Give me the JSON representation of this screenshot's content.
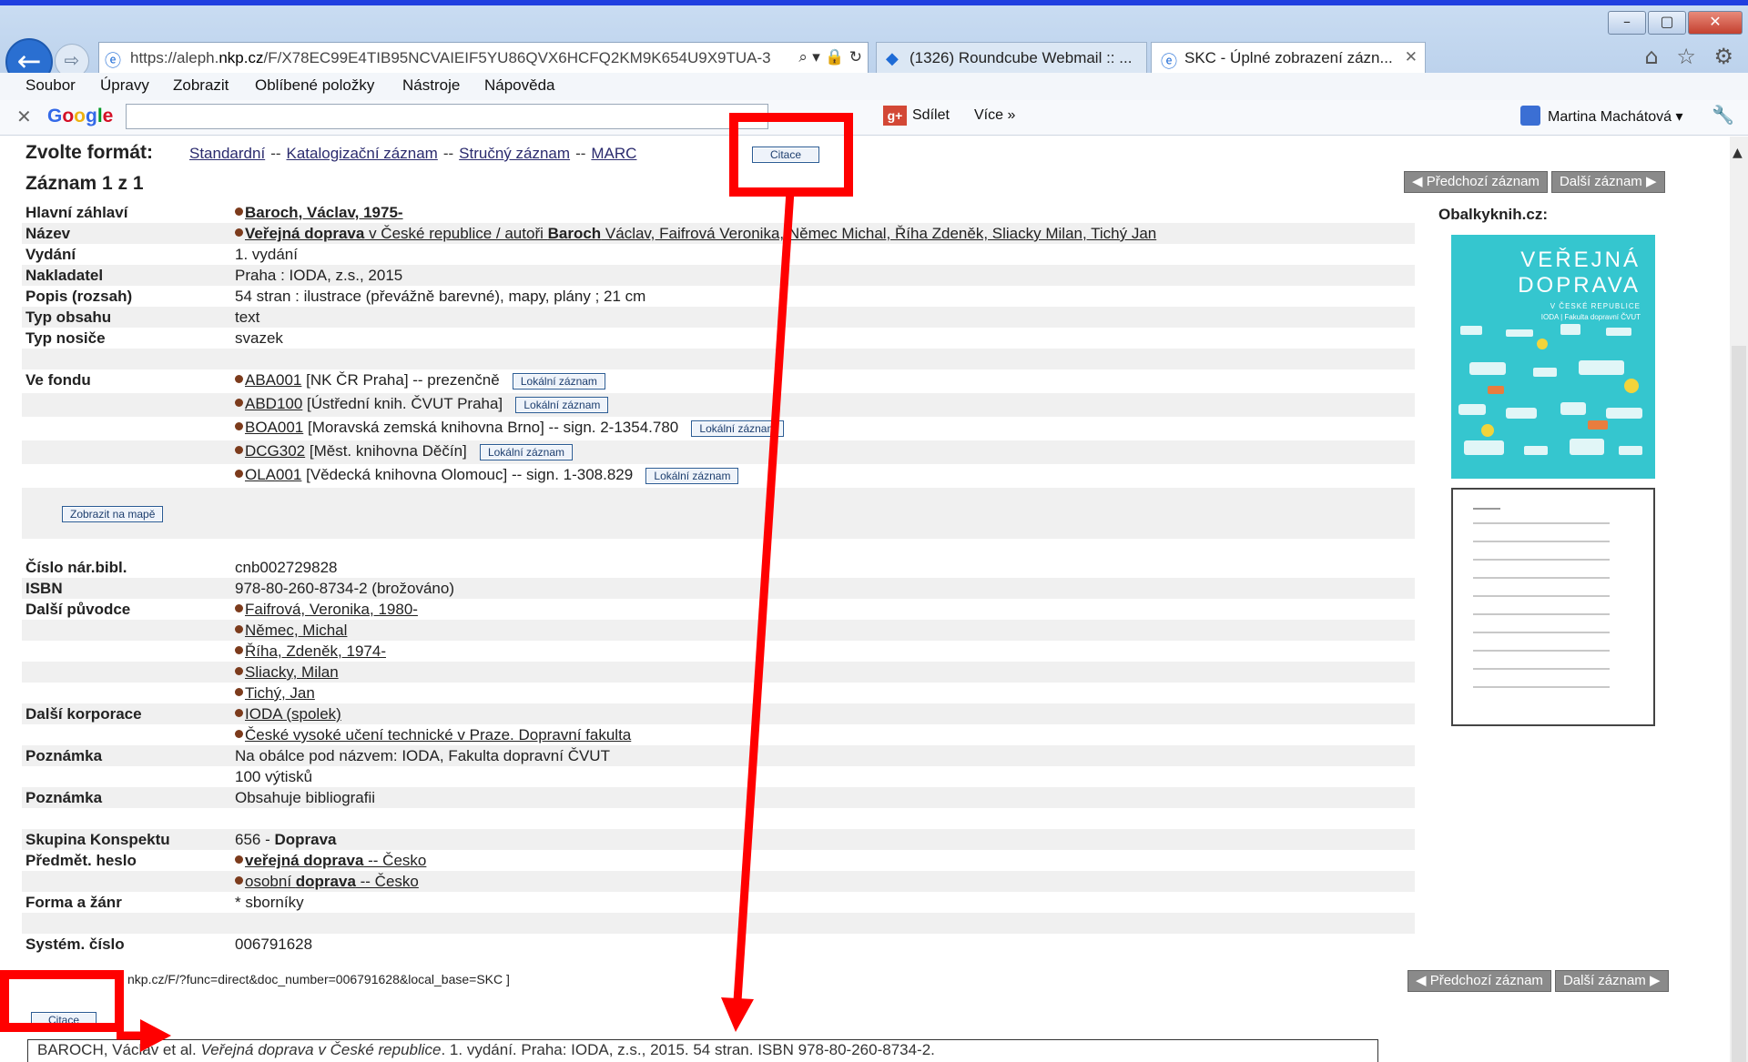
{
  "browser": {
    "url_prefix": "https://aleph.",
    "url_domain": "nkp.cz",
    "url_rest": "/F/X78EC99E4TIB95NCVAIEIF5YU86QVX6HCFQ2KM9K654U9X9TUA-3",
    "addr_tools": "⌕ ▾ 🔒 ↻",
    "tabs": [
      {
        "label": "(1326) Roundcube Webmail :: ..."
      },
      {
        "label": "SKC - Úplné zobrazení zázn...",
        "close": "✕"
      }
    ],
    "window_buttons": [
      "–",
      "▢",
      "✕"
    ],
    "tool_icons": "⌂ ☆ ⚙"
  },
  "menu": [
    "Soubor",
    "Úpravy",
    "Zobrazit",
    "Oblíbené položky",
    "Nástroje",
    "Nápověda"
  ],
  "google_toolbar": {
    "close": "✕",
    "logo": "Google",
    "share": "Sdílet",
    "more": "Více »",
    "user": "Martina Machátová ▾",
    "wrench": "🔧"
  },
  "page": {
    "format_label": "Zvolte formát:",
    "formats": [
      "Standardní",
      "Katalogizační záznam",
      "Stručný záznam",
      "MARC"
    ],
    "format_sep": "--",
    "citace_button": "Citace",
    "record_title": "Záznam 1 z 1",
    "prev_record": "◀ Předchozí záznam",
    "next_record": "Další záznam ▶",
    "cover_label": "Obalkyknih.cz:",
    "cover_title_1": "VEŘEJNÁ",
    "cover_title_2": "DOPRAVA",
    "cover_subtitle": "V ČESKÉ REPUBLICE",
    "cover_footer": "IODA | Fakulta dopravní ČVUT",
    "map_button": "Zobrazit na mapě",
    "local_record_button": "Lokální záznam",
    "fields": {
      "hlavni_zahlavi": {
        "label": "Hlavní záhlaví",
        "value": "Baroch, Václav, 1975-"
      },
      "nazev": {
        "label": "Název",
        "value_title": "Veřejná doprava",
        "value_rest": " v České republice / autoři ",
        "value_author": "Baroch",
        "value_tail": " Václav, Faifrová Veronika, Němec Michal, Říha Zdeněk, Sliacky Milan, Tichý Jan"
      },
      "vydani": {
        "label": "Vydání",
        "value": "1. vydání"
      },
      "nakladatel": {
        "label": "Nakladatel",
        "value": "Praha : IODA, z.s., 2015"
      },
      "popis": {
        "label": "Popis (rozsah)",
        "value": "54 stran : ilustrace (převážně barevné), mapy, plány ; 21 cm"
      },
      "typ_obsahu": {
        "label": "Typ obsahu",
        "value": "text"
      },
      "typ_nosice": {
        "label": "Typ nosiče",
        "value": "svazek"
      },
      "ve_fondu": {
        "label": "Ve fondu",
        "items": [
          {
            "code": "ABA001",
            "text": " [NK ČR Praha] -- prezenčně"
          },
          {
            "code": "ABD100",
            "text": " [Ústřední knih. ČVUT Praha]"
          },
          {
            "code": "BOA001",
            "text": " [Moravská zemská knihovna Brno] -- sign. 2-1354.780"
          },
          {
            "code": "DCG302",
            "text": " [Měst. knihovna Děčín]"
          },
          {
            "code": "OLA001",
            "text": " [Vědecká knihovna Olomouc] -- sign. 1-308.829"
          }
        ]
      },
      "cislo_nar": {
        "label": "Číslo nár.bibl.",
        "value": "cnb002729828"
      },
      "isbn": {
        "label": "ISBN",
        "value": "978-80-260-8734-2 (brožováno)"
      },
      "dalsi_puvodce": {
        "label": "Další původce",
        "items": [
          "Faifrová, Veronika, 1980-",
          "Němec, Michal",
          "Říha, Zdeněk, 1974-",
          "Sliacky, Milan",
          "Tichý, Jan"
        ]
      },
      "dalsi_korporace": {
        "label": "Další korporace",
        "items": [
          "IODA (spolek)",
          "České vysoké učení technické v Praze. Dopravní fakulta"
        ]
      },
      "poznamka1": {
        "label": "Poznámka",
        "value": "Na obálce pod názvem: IODA, Fakulta dopravní ČVUT",
        "value2": "100 výtisků"
      },
      "poznamka2": {
        "label": "Poznámka",
        "value": "Obsahuje bibliografii"
      },
      "skupina": {
        "label": "Skupina Konspektu",
        "value_num": "656 - ",
        "value_bold": "Doprava"
      },
      "predmet": {
        "label": "Předmět. heslo",
        "items": [
          {
            "pre": "",
            "bold": "veřejná doprava",
            "post": " -- Česko"
          },
          {
            "pre": "osobní ",
            "bold": "doprava",
            "post": " -- Česko"
          }
        ]
      },
      "forma": {
        "label": "Forma a žánr",
        "value": "* sborníky"
      },
      "system": {
        "label": "Systém. číslo",
        "value": "006791628"
      }
    },
    "permalink": "nkp.cz/F/?func=direct&doc_number=006791628&local_base=SKC ]",
    "citation_author": "BAROCH, Václav et al. ",
    "citation_title": "Veřejná doprava v České republice",
    "citation_rest": ". 1. vydání. Praha: IODA, z.s., 2015. 54 stran. ISBN 978-80-260-8734-2."
  },
  "annotation_color": "#ff0000"
}
